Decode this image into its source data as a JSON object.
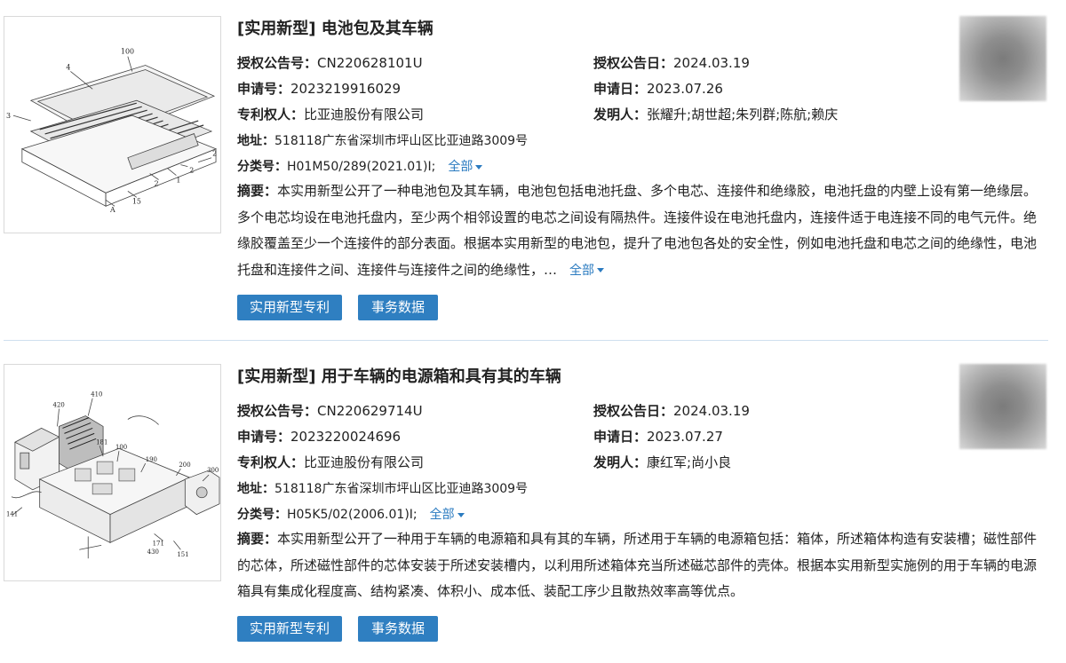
{
  "records": [
    {
      "title": "[实用新型] 电池包及其车辆",
      "pub_no_label": "授权公告号：",
      "pub_no": "CN220628101U",
      "pub_date_label": "授权公告日：",
      "pub_date": "2024.03.19",
      "app_no_label": "申请号：",
      "app_no": "2023219916029",
      "app_date_label": "申请日：",
      "app_date": "2023.07.26",
      "owner_label": "专利权人：",
      "owner": "比亚迪股份有限公司",
      "inventor_label": "发明人：",
      "inventors": "张耀升;胡世超;朱列群;陈航;赖庆",
      "address_label": "地址：",
      "address": "518118广东省深圳市坪山区比亚迪路3009号",
      "class_label": "分类号：",
      "class": "H01M50/289(2021.01)I;",
      "class_more": "全部",
      "abstract_label": "摘要：",
      "abstract": "本实用新型公开了一种电池包及其车辆，电池包包括电池托盘、多个电芯、连接件和绝缘胶，电池托盘的内壁上设有第一绝缘层。多个电芯均设在电池托盘内，至少两个相邻设置的电芯之间设有隔热件。连接件设在电池托盘内，连接件适于电连接不同的电气元件。绝缘胶覆盖至少一个连接件的部分表面。根据本实用新型的电池包，提升了电池包各处的安全性，例如电池托盘和电芯之间的绝缘性，电池托盘和连接件之间、连接件与连接件之间的绝缘性，…",
      "abstract_more": "全部",
      "btn_type": "实用新型专利",
      "btn_data": "事务数据"
    },
    {
      "title": "[实用新型] 用于车辆的电源箱和具有其的车辆",
      "pub_no_label": "授权公告号：",
      "pub_no": "CN220629714U",
      "pub_date_label": "授权公告日：",
      "pub_date": "2024.03.19",
      "app_no_label": "申请号：",
      "app_no": "2023220024696",
      "app_date_label": "申请日：",
      "app_date": "2023.07.27",
      "owner_label": "专利权人：",
      "owner": "比亚迪股份有限公司",
      "inventor_label": "发明人：",
      "inventors": "康红军;尚小良",
      "address_label": "地址：",
      "address": "518118广东省深圳市坪山区比亚迪路3009号",
      "class_label": "分类号：",
      "class": "H05K5/02(2006.01)I;",
      "class_more": "全部",
      "abstract_label": "摘要：",
      "abstract": "本实用新型公开了一种用于车辆的电源箱和具有其的车辆，所述用于车辆的电源箱包括：箱体，所述箱体构造有安装槽；磁性部件的芯体，所述磁性部件的芯体安装于所述安装槽内，以利用所述箱体充当所述磁芯部件的壳体。根据本实用新型实施例的用于车辆的电源箱具有集成化程度高、结构紧凑、体积小、成本低、装配工序少且散热效率高等优点。",
      "btn_type": "实用新型专利",
      "btn_data": "事务数据"
    }
  ],
  "figure1_labels": [
    "100",
    "4",
    "3",
    "2",
    "2",
    "1",
    "2",
    "15",
    "A"
  ],
  "figure2_labels": [
    "420",
    "410",
    "181",
    "100",
    "190",
    "200",
    "300",
    "141",
    "171",
    "430",
    "151"
  ]
}
